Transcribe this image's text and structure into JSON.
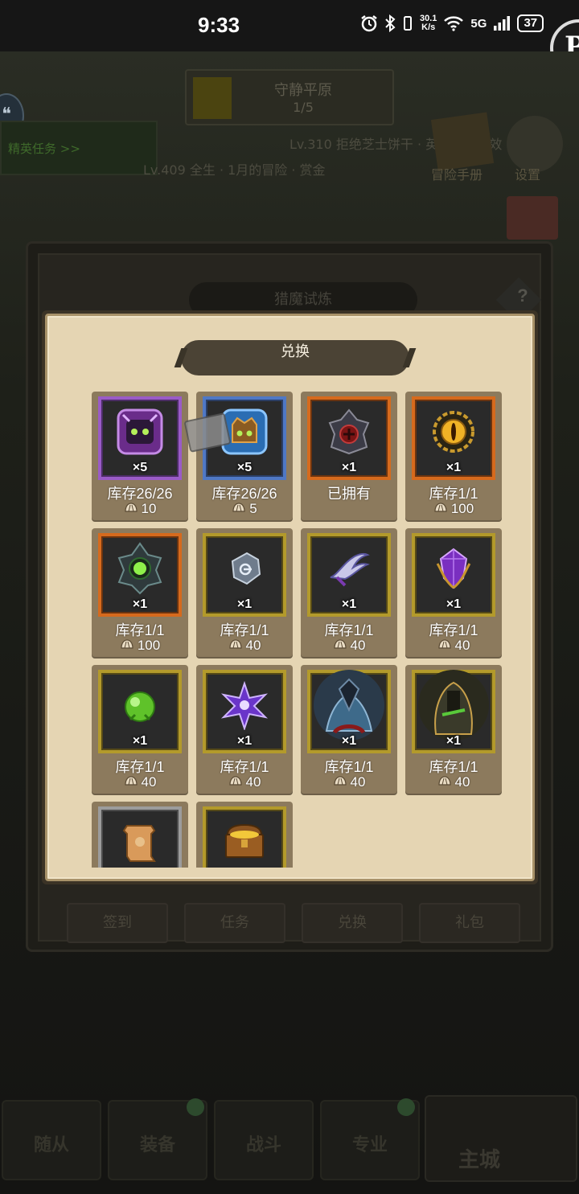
{
  "status_bar": {
    "time": "9:33",
    "net_speed_value": "30.1",
    "net_speed_unit": "K/s",
    "signal_label": "5G",
    "battery": "37"
  },
  "floating_app": {
    "letter": "P"
  },
  "background": {
    "banner_title": "守静平原",
    "banner_count": "1/5",
    "task_label": "精英任务 >>",
    "line1": "Lv.310  拒绝芝士饼干 · 英灵节 · 文效",
    "line2": "Lv.409  全生 · 1月的冒险 · 赏金",
    "guide_label": "冒险手册",
    "settings_label": "设置",
    "bottom_tabs": [
      "随从",
      "装备",
      "战斗",
      "专业"
    ],
    "home_label": "主城"
  },
  "outer_dialog": {
    "title": "猎魔试炼",
    "help": "?",
    "tabs": [
      "签到",
      "任务",
      "兑换",
      "礼包"
    ]
  },
  "exchange": {
    "title": "兑换",
    "items": [
      {
        "icon": "purple-chest-icon",
        "rarity": "purple",
        "qty": "×5",
        "stock": "库存26/26",
        "price": "10"
      },
      {
        "icon": "blue-chest-icon",
        "rarity": "blue",
        "qty": "×5",
        "stock": "库存26/26",
        "price": "5"
      },
      {
        "icon": "dark-helmet-icon",
        "rarity": "orange",
        "qty": "×1",
        "stock": "已拥有",
        "price": ""
      },
      {
        "icon": "gold-eye-orb-icon",
        "rarity": "orange",
        "qty": "×1",
        "stock": "库存1/1",
        "price": "100"
      },
      {
        "icon": "green-eye-amulet-icon",
        "rarity": "orange",
        "qty": "×1",
        "stock": "库存1/1",
        "price": "100"
      },
      {
        "icon": "silver-stone-icon",
        "rarity": "gold",
        "qty": "×1",
        "stock": "库存1/1",
        "price": "40"
      },
      {
        "icon": "claw-blade-icon",
        "rarity": "gold",
        "qty": "×1",
        "stock": "库存1/1",
        "price": "40"
      },
      {
        "icon": "purple-gem-icon",
        "rarity": "gold",
        "qty": "×1",
        "stock": "库存1/1",
        "price": "40"
      },
      {
        "icon": "green-orb-icon",
        "rarity": "gold",
        "qty": "×1",
        "stock": "库存1/1",
        "price": "40"
      },
      {
        "icon": "purple-star-icon",
        "rarity": "gold",
        "qty": "×1",
        "stock": "库存1/1",
        "price": "40"
      },
      {
        "icon": "knight-portrait-icon",
        "rarity": "gold",
        "qty": "×1",
        "stock": "库存1/1",
        "price": "40"
      },
      {
        "icon": "hooded-portrait-icon",
        "rarity": "gold",
        "qty": "×1",
        "stock": "库存1/1",
        "price": "40"
      },
      {
        "icon": "scroll-icon",
        "rarity": "grey",
        "qty": "",
        "stock": "",
        "price": ""
      },
      {
        "icon": "treasure-chest-icon",
        "rarity": "gold",
        "qty": "",
        "stock": "",
        "price": ""
      }
    ]
  },
  "colors": {
    "panel_face": "#e5d5b3",
    "cell_bg": "#8c7a5d",
    "frame_purple": "#9a5bc7",
    "frame_blue": "#4f78c5",
    "frame_orange": "#d66a1d",
    "frame_gold": "#b39a2b"
  }
}
